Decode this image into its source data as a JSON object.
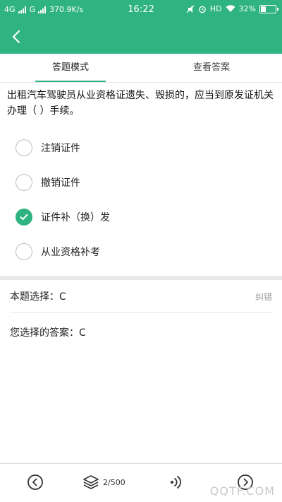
{
  "status_bar": {
    "network_1": "4G",
    "network_2": "G",
    "speed": "370.9K/s",
    "time": "16:22",
    "hd": "HD",
    "battery": "32%"
  },
  "tabs": [
    {
      "label": "答题模式",
      "active": true
    },
    {
      "label": "查看答案",
      "active": false
    }
  ],
  "question": {
    "text": "出租汽车驾驶员从业资格证遗失、毁损的，应当到原发证机关办理（ ）手续。",
    "options": [
      {
        "label": "注销证件",
        "checked": false
      },
      {
        "label": "撤销证件",
        "checked": false
      },
      {
        "label": "证件补（换）发",
        "checked": true
      },
      {
        "label": "从业资格补考",
        "checked": false
      }
    ]
  },
  "answer": {
    "correct_text": "本题选择：C",
    "report_label": "纠错",
    "yours_text": "您选择的答案：C"
  },
  "bottom_bar": {
    "counter": "2/500"
  },
  "watermark": "QQTF.COM",
  "colors": {
    "accent": "#2fb380",
    "radio_border": "#bdbdbd"
  }
}
